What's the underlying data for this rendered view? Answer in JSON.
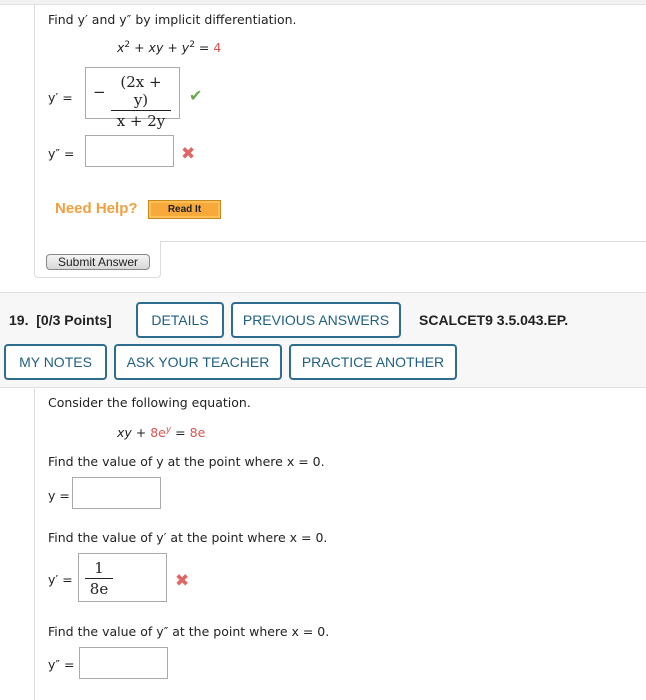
{
  "q18": {
    "prompt": "Find y′ and y″ by implicit differentiation.",
    "equation": {
      "lhs_a": "x",
      "sup_a": "2",
      "mid": " + xy + y",
      "sup_b": "2",
      "eq": " = ",
      "rhs": "4"
    },
    "yprime_label": "y′ =",
    "yprime_answer": {
      "sign": "−",
      "numerator": "(2x + y)",
      "denominator": "x + 2y"
    },
    "yprime_status": "correct",
    "ydouble_label": "y″ =",
    "ydouble_value": "",
    "ydouble_status": "incorrect",
    "need_help": "Need Help?",
    "read_it": "Read It",
    "submit": "Submit Answer"
  },
  "q19": {
    "number": "19.",
    "points": "[0/3 Points]",
    "buttons": {
      "details": "DETAILS",
      "previous_answers": "PREVIOUS ANSWERS",
      "my_notes": "MY NOTES",
      "ask_teacher": "ASK YOUR TEACHER",
      "practice_another": "PRACTICE ANOTHER"
    },
    "code": "SCALCET9 3.5.043.EP.",
    "prompt": "Consider the following equation.",
    "equation": {
      "a": "xy + ",
      "b": "8e",
      "sup": "y",
      "eq": " = ",
      "rhs": "8e"
    },
    "part1_prompt": "Find the value of y at the point where x = 0.",
    "part1_label": "y =",
    "part1_value": "",
    "part2_prompt": "Find the value of y′ at the point where x = 0.",
    "part2_label": "y′ =",
    "part2_answer": {
      "numerator": "1",
      "denominator": "8e"
    },
    "part2_status": "incorrect",
    "part3_prompt": "Find the value of y″ at the point where x = 0.",
    "part3_label": "y″ =",
    "part3_value": ""
  },
  "icons": {
    "correct": "✔",
    "incorrect": "✖"
  },
  "colors": {
    "accent": "#2e6d8e",
    "correct": "#6aa84f",
    "incorrect": "#e06666",
    "help": "#f0a040"
  }
}
